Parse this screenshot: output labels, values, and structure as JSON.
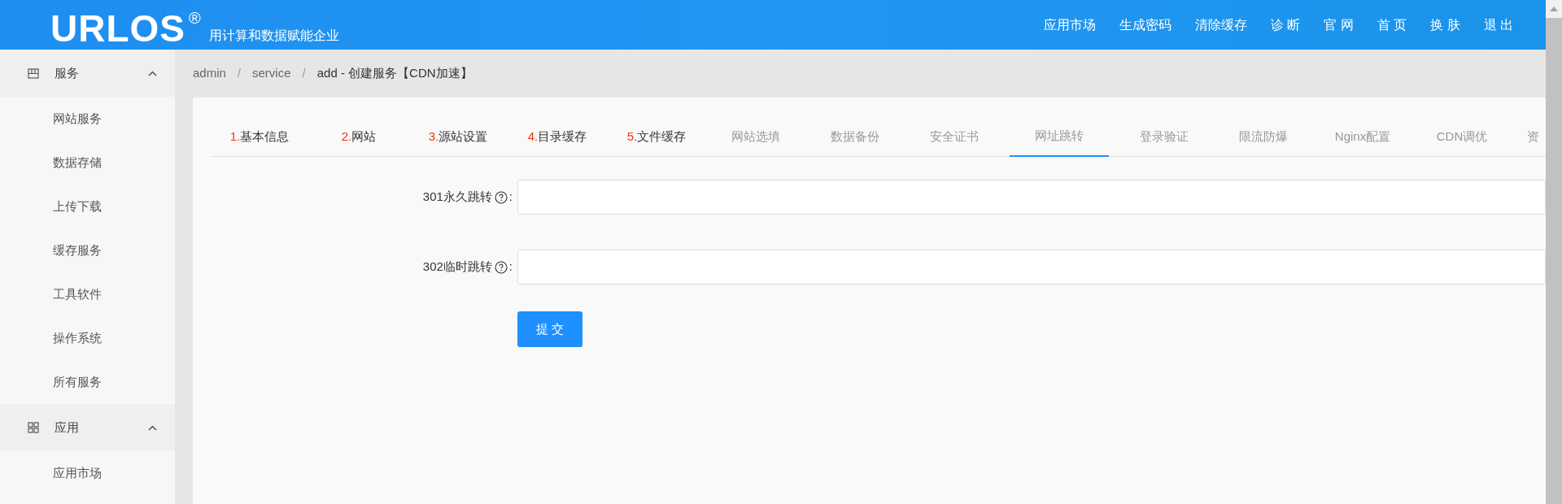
{
  "header": {
    "logo": "URLOS",
    "registered_mark": "®",
    "tagline": "用计算和数据赋能企业",
    "nav": [
      "应用市场",
      "生成密码",
      "清除缓存",
      "诊 断",
      "官 网",
      "首 页",
      "换 肤",
      "退 出"
    ]
  },
  "sidebar": {
    "groups": [
      {
        "label": "服务",
        "kind": "services",
        "expanded": true,
        "items": [
          "网站服务",
          "数据存储",
          "上传下载",
          "缓存服务",
          "工具软件",
          "操作系统",
          "所有服务"
        ]
      },
      {
        "label": "应用",
        "kind": "grid",
        "expanded": true,
        "items": [
          "应用市场"
        ]
      }
    ]
  },
  "breadcrumb": {
    "separator": "/",
    "items": [
      "admin",
      "service",
      "add - 创建服务【CDN加速】"
    ]
  },
  "tabs": [
    {
      "number": "1.",
      "label": "基本信息",
      "disabled": false,
      "selected": false
    },
    {
      "number": "2.",
      "label": "网站",
      "disabled": false,
      "selected": false
    },
    {
      "number": "3.",
      "label": "源站设置",
      "disabled": false,
      "selected": false
    },
    {
      "number": "4.",
      "label": "目录缓存",
      "disabled": false,
      "selected": false
    },
    {
      "number": "5.",
      "label": "文件缓存",
      "disabled": false,
      "selected": false
    },
    {
      "label": "网站选填",
      "disabled": true,
      "selected": false
    },
    {
      "label": "数据备份",
      "disabled": true,
      "selected": false
    },
    {
      "label": "安全证书",
      "disabled": true,
      "selected": false
    },
    {
      "label": "网址跳转",
      "disabled": true,
      "selected": true
    },
    {
      "label": "登录验证",
      "disabled": true,
      "selected": false
    },
    {
      "label": "限流防爆",
      "disabled": true,
      "selected": false
    },
    {
      "label": "Nginx配置",
      "disabled": true,
      "selected": false
    },
    {
      "label": "CDN调优",
      "disabled": true,
      "selected": false
    },
    {
      "label": "资",
      "disabled": true,
      "selected": false
    }
  ],
  "form": {
    "fields": [
      {
        "label": "301永久跳转",
        "colon": ":"
      },
      {
        "label": "302临时跳转",
        "colon": ":"
      }
    ],
    "submit": "提 交"
  }
}
